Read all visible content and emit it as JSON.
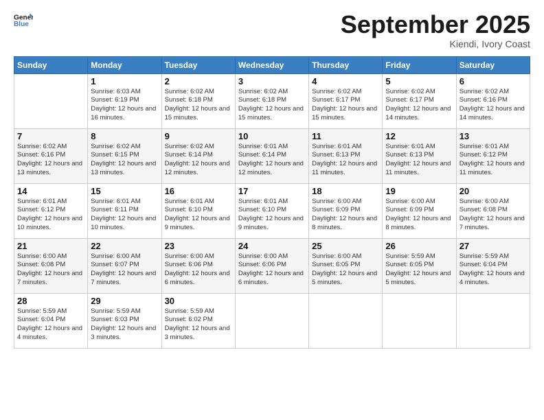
{
  "header": {
    "logo_general": "General",
    "logo_blue": "Blue",
    "month": "September 2025",
    "location": "Kiendi, Ivory Coast"
  },
  "weekdays": [
    "Sunday",
    "Monday",
    "Tuesday",
    "Wednesday",
    "Thursday",
    "Friday",
    "Saturday"
  ],
  "weeks": [
    [
      {
        "day": "",
        "sunrise": "",
        "sunset": "",
        "daylight": ""
      },
      {
        "day": "1",
        "sunrise": "Sunrise: 6:03 AM",
        "sunset": "Sunset: 6:19 PM",
        "daylight": "Daylight: 12 hours and 16 minutes."
      },
      {
        "day": "2",
        "sunrise": "Sunrise: 6:02 AM",
        "sunset": "Sunset: 6:18 PM",
        "daylight": "Daylight: 12 hours and 15 minutes."
      },
      {
        "day": "3",
        "sunrise": "Sunrise: 6:02 AM",
        "sunset": "Sunset: 6:18 PM",
        "daylight": "Daylight: 12 hours and 15 minutes."
      },
      {
        "day": "4",
        "sunrise": "Sunrise: 6:02 AM",
        "sunset": "Sunset: 6:17 PM",
        "daylight": "Daylight: 12 hours and 15 minutes."
      },
      {
        "day": "5",
        "sunrise": "Sunrise: 6:02 AM",
        "sunset": "Sunset: 6:17 PM",
        "daylight": "Daylight: 12 hours and 14 minutes."
      },
      {
        "day": "6",
        "sunrise": "Sunrise: 6:02 AM",
        "sunset": "Sunset: 6:16 PM",
        "daylight": "Daylight: 12 hours and 14 minutes."
      }
    ],
    [
      {
        "day": "7",
        "sunrise": "Sunrise: 6:02 AM",
        "sunset": "Sunset: 6:16 PM",
        "daylight": "Daylight: 12 hours and 13 minutes."
      },
      {
        "day": "8",
        "sunrise": "Sunrise: 6:02 AM",
        "sunset": "Sunset: 6:15 PM",
        "daylight": "Daylight: 12 hours and 13 minutes."
      },
      {
        "day": "9",
        "sunrise": "Sunrise: 6:02 AM",
        "sunset": "Sunset: 6:14 PM",
        "daylight": "Daylight: 12 hours and 12 minutes."
      },
      {
        "day": "10",
        "sunrise": "Sunrise: 6:01 AM",
        "sunset": "Sunset: 6:14 PM",
        "daylight": "Daylight: 12 hours and 12 minutes."
      },
      {
        "day": "11",
        "sunrise": "Sunrise: 6:01 AM",
        "sunset": "Sunset: 6:13 PM",
        "daylight": "Daylight: 12 hours and 11 minutes."
      },
      {
        "day": "12",
        "sunrise": "Sunrise: 6:01 AM",
        "sunset": "Sunset: 6:13 PM",
        "daylight": "Daylight: 12 hours and 11 minutes."
      },
      {
        "day": "13",
        "sunrise": "Sunrise: 6:01 AM",
        "sunset": "Sunset: 6:12 PM",
        "daylight": "Daylight: 12 hours and 11 minutes."
      }
    ],
    [
      {
        "day": "14",
        "sunrise": "Sunrise: 6:01 AM",
        "sunset": "Sunset: 6:12 PM",
        "daylight": "Daylight: 12 hours and 10 minutes."
      },
      {
        "day": "15",
        "sunrise": "Sunrise: 6:01 AM",
        "sunset": "Sunset: 6:11 PM",
        "daylight": "Daylight: 12 hours and 10 minutes."
      },
      {
        "day": "16",
        "sunrise": "Sunrise: 6:01 AM",
        "sunset": "Sunset: 6:10 PM",
        "daylight": "Daylight: 12 hours and 9 minutes."
      },
      {
        "day": "17",
        "sunrise": "Sunrise: 6:01 AM",
        "sunset": "Sunset: 6:10 PM",
        "daylight": "Daylight: 12 hours and 9 minutes."
      },
      {
        "day": "18",
        "sunrise": "Sunrise: 6:00 AM",
        "sunset": "Sunset: 6:09 PM",
        "daylight": "Daylight: 12 hours and 8 minutes."
      },
      {
        "day": "19",
        "sunrise": "Sunrise: 6:00 AM",
        "sunset": "Sunset: 6:09 PM",
        "daylight": "Daylight: 12 hours and 8 minutes."
      },
      {
        "day": "20",
        "sunrise": "Sunrise: 6:00 AM",
        "sunset": "Sunset: 6:08 PM",
        "daylight": "Daylight: 12 hours and 7 minutes."
      }
    ],
    [
      {
        "day": "21",
        "sunrise": "Sunrise: 6:00 AM",
        "sunset": "Sunset: 6:08 PM",
        "daylight": "Daylight: 12 hours and 7 minutes."
      },
      {
        "day": "22",
        "sunrise": "Sunrise: 6:00 AM",
        "sunset": "Sunset: 6:07 PM",
        "daylight": "Daylight: 12 hours and 7 minutes."
      },
      {
        "day": "23",
        "sunrise": "Sunrise: 6:00 AM",
        "sunset": "Sunset: 6:06 PM",
        "daylight": "Daylight: 12 hours and 6 minutes."
      },
      {
        "day": "24",
        "sunrise": "Sunrise: 6:00 AM",
        "sunset": "Sunset: 6:06 PM",
        "daylight": "Daylight: 12 hours and 6 minutes."
      },
      {
        "day": "25",
        "sunrise": "Sunrise: 6:00 AM",
        "sunset": "Sunset: 6:05 PM",
        "daylight": "Daylight: 12 hours and 5 minutes."
      },
      {
        "day": "26",
        "sunrise": "Sunrise: 5:59 AM",
        "sunset": "Sunset: 6:05 PM",
        "daylight": "Daylight: 12 hours and 5 minutes."
      },
      {
        "day": "27",
        "sunrise": "Sunrise: 5:59 AM",
        "sunset": "Sunset: 6:04 PM",
        "daylight": "Daylight: 12 hours and 4 minutes."
      }
    ],
    [
      {
        "day": "28",
        "sunrise": "Sunrise: 5:59 AM",
        "sunset": "Sunset: 6:04 PM",
        "daylight": "Daylight: 12 hours and 4 minutes."
      },
      {
        "day": "29",
        "sunrise": "Sunrise: 5:59 AM",
        "sunset": "Sunset: 6:03 PM",
        "daylight": "Daylight: 12 hours and 3 minutes."
      },
      {
        "day": "30",
        "sunrise": "Sunrise: 5:59 AM",
        "sunset": "Sunset: 6:02 PM",
        "daylight": "Daylight: 12 hours and 3 minutes."
      },
      {
        "day": "",
        "sunrise": "",
        "sunset": "",
        "daylight": ""
      },
      {
        "day": "",
        "sunrise": "",
        "sunset": "",
        "daylight": ""
      },
      {
        "day": "",
        "sunrise": "",
        "sunset": "",
        "daylight": ""
      },
      {
        "day": "",
        "sunrise": "",
        "sunset": "",
        "daylight": ""
      }
    ]
  ]
}
